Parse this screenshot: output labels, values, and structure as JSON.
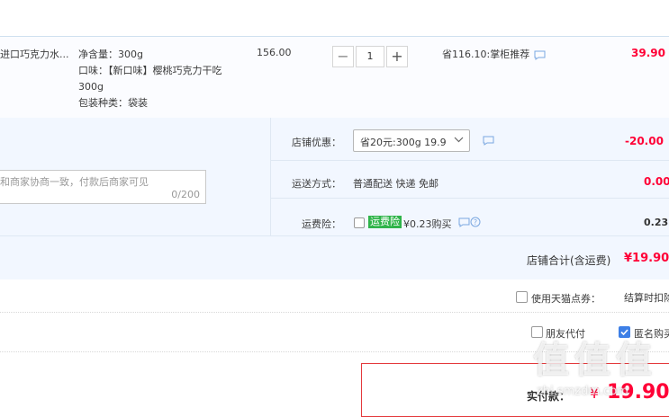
{
  "item": {
    "name": "进口巧克力水...",
    "sku": {
      "weight": "净含量：300g",
      "flavor_line1": "口味：【新口味】樱桃巧克力干吃",
      "flavor_line2": "300g",
      "package": "包装种类：袋装"
    },
    "unit_price": "156.00",
    "qty_minus": "−",
    "quantity": "1",
    "qty_plus": "+",
    "saving": "省116.10:掌柜推荐",
    "subtotal": "39.90"
  },
  "message": {
    "placeholder": "和商家协商一致，付款后商家可见",
    "counter": "0/200"
  },
  "shop_discount": {
    "label": "店铺优惠：",
    "selected": "省20元:300g 19.9",
    "amount": "-20.00"
  },
  "shipping": {
    "label": "运送方式：",
    "value": "普通配送 快递 免邮",
    "amount": "0.00"
  },
  "insurance": {
    "label": "运费险：",
    "tag": "运费险",
    "price": "¥0.23购买",
    "amount": "0.23"
  },
  "shop_total": {
    "label": "店铺合计(含运费)",
    "amount": "¥19.90"
  },
  "tmall_points": {
    "label": "使用天猫点券：",
    "note": "结算时扣除"
  },
  "options": {
    "friend_pay": "朋友代付",
    "anonymous": "匿名购买"
  },
  "payment": {
    "label": "实付款：",
    "currency": "¥",
    "amount": "19.90"
  },
  "watermark": "值 值 值",
  "watermark_sub": "zhi.smzdm.com",
  "colors": {
    "accent_red": "#ff0036",
    "checkbox_blue": "#3d7fe6",
    "tag_green": "#2fb44a"
  }
}
